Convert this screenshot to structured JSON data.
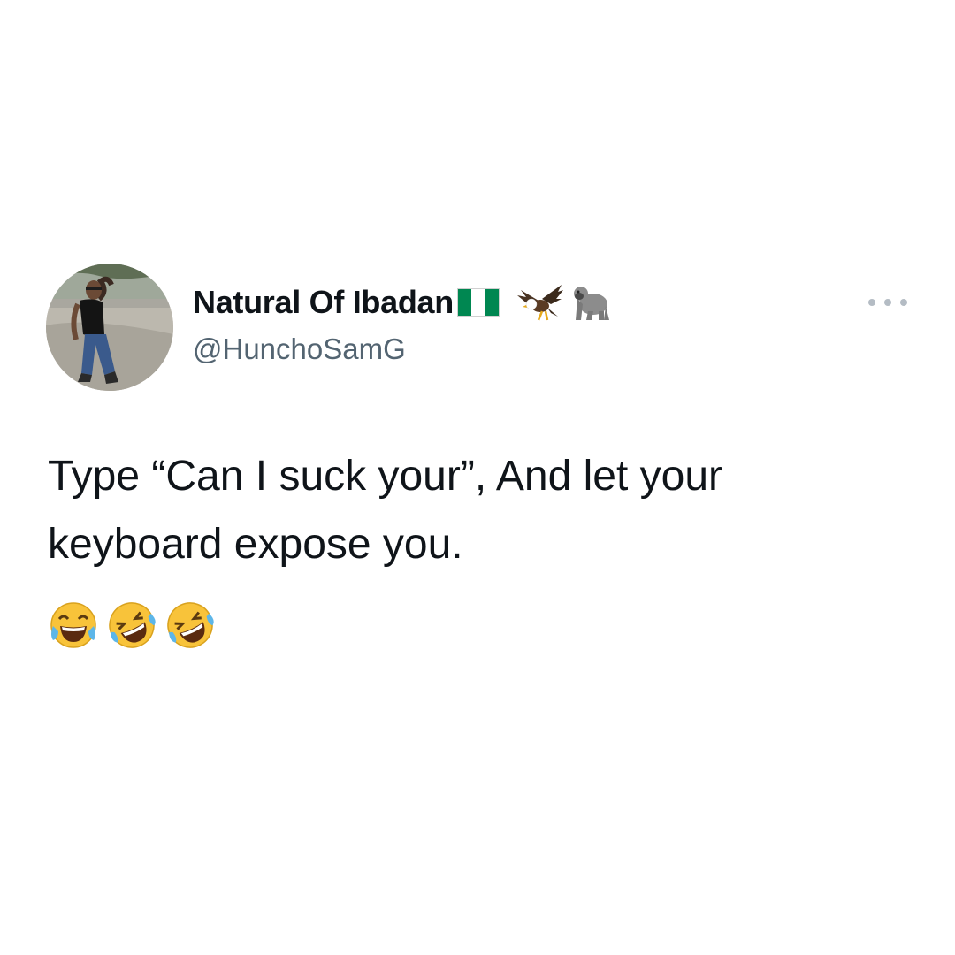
{
  "tweet": {
    "display_name": "Natural Of Ibadan",
    "handle": "@HunchoSamG",
    "text_line1": "Type “Can I suck your”, And let your",
    "text_line2": "keyboard expose you.",
    "name_emojis": [
      "nigeria-flag-icon",
      "eagle-icon",
      "gorilla-icon"
    ],
    "body_emojis": [
      "face-with-tears-of-joy-icon",
      "rolling-on-the-floor-laughing-icon",
      "rolling-on-the-floor-laughing-icon"
    ]
  },
  "colors": {
    "background": "#ffffff",
    "text_primary": "#0f1419",
    "text_secondary": "#536471",
    "nigeria_green": "#008751",
    "emoji_yellow": "#f8c33a",
    "tear_blue": "#5db6e8"
  }
}
